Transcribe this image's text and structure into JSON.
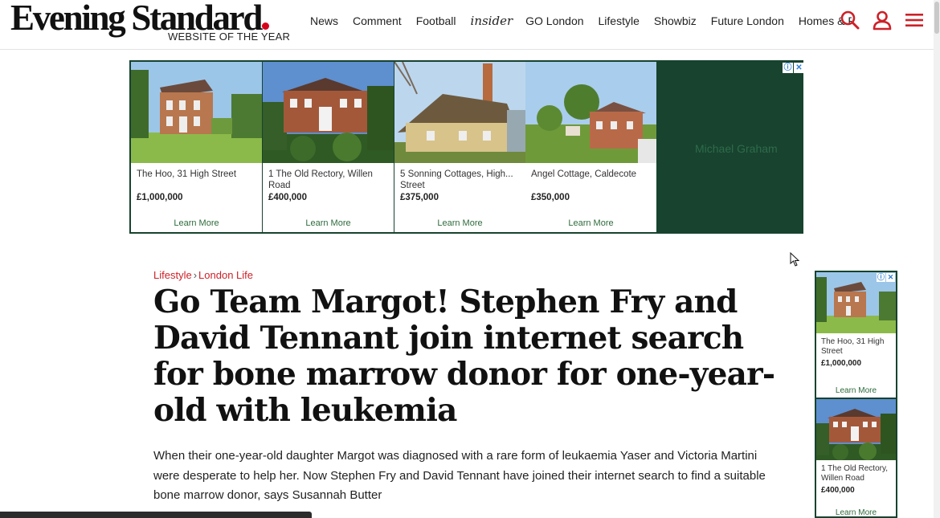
{
  "brand": {
    "name": "Evening Standard",
    "tagline": "WEBSITE OF THE YEAR",
    "dot_color": "#d6001c"
  },
  "nav": [
    {
      "label": "News"
    },
    {
      "label": "Comment"
    },
    {
      "label": "Football"
    },
    {
      "label": "insider"
    },
    {
      "label": "GO London"
    },
    {
      "label": "Lifestyle"
    },
    {
      "label": "Showbiz"
    },
    {
      "label": "Future London"
    },
    {
      "label": "Homes & P"
    }
  ],
  "header_icons": [
    "search-icon",
    "account-icon",
    "menu-icon"
  ],
  "accent_color": "#cc2128",
  "ad_top": {
    "brand": "Michael Graham",
    "background": "#17432f",
    "listings": [
      {
        "address": "The Hoo, 31 High Street",
        "price": "£1,000,000",
        "cta": "Learn More"
      },
      {
        "address": "1 The Old Rectory, Willen Road",
        "price": "£400,000",
        "cta": "Learn More"
      },
      {
        "address": "5 Sonning Cottages, High... Street",
        "price": "£375,000",
        "cta": "Learn More"
      },
      {
        "address": "Angel Cottage, Caldecote",
        "price": "£350,000",
        "cta": "Learn More"
      }
    ]
  },
  "article": {
    "section": "Lifestyle",
    "separator": "›",
    "subsection": "London Life",
    "headline": "Go Team Margot! Stephen Fry and David Tennant join internet search for bone marrow donor for one-year-old with leukemia",
    "standfirst": "When their one-year-old daughter Margot was diagnosed with a rare form of leukaemia Yaser and Victoria Martini were desperate to help her. Now Stephen Fry and David Tennant have joined their internet search to find a suitable bone marrow donor, says Susannah Butter"
  },
  "ad_side": {
    "listings": [
      {
        "address": "The Hoo, 31 High Street",
        "price": "£1,000,000",
        "cta": "Learn More"
      },
      {
        "address": "1 The Old Rectory, Willen Road",
        "price": "£400,000",
        "cta": "Learn More"
      }
    ]
  }
}
